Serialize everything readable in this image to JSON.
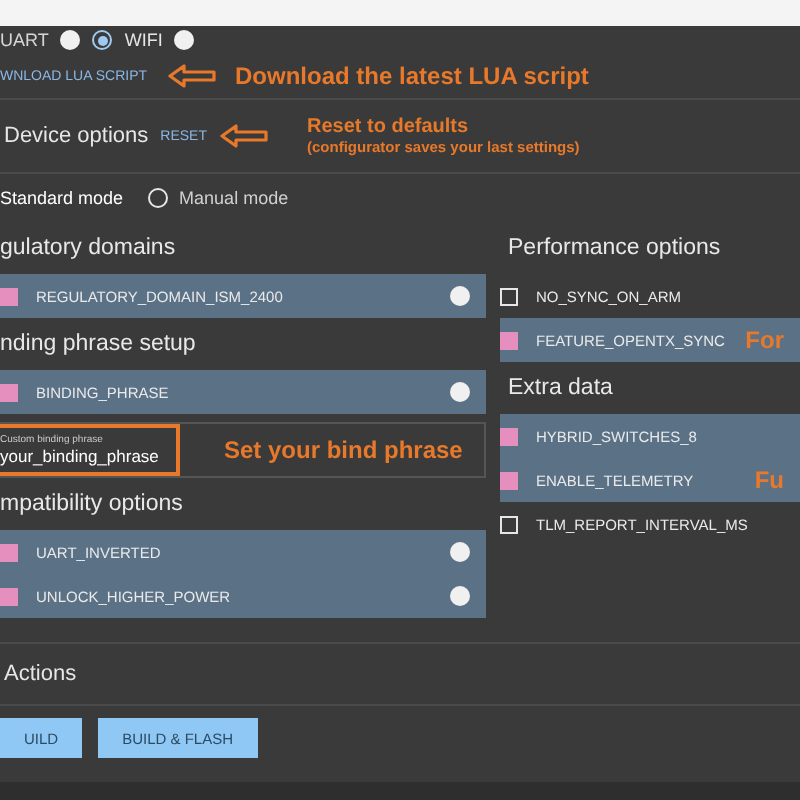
{
  "connection": {
    "options": [
      {
        "label": "UART",
        "selected": false
      },
      {
        "label": "WIFI",
        "selected": true
      }
    ]
  },
  "download": {
    "link": "WNLOAD LUA SCRIPT",
    "note": "Download the latest LUA script"
  },
  "device_options": {
    "title": "Device options",
    "reset": "RESET",
    "note_title": "Reset to defaults",
    "note_subtitle": "(configurator saves your last settings)"
  },
  "modes": [
    {
      "label": "Standard mode",
      "selected": true
    },
    {
      "label": "Manual mode",
      "selected": false
    }
  ],
  "left_groups": [
    {
      "title": "gulatory domains",
      "options": [
        {
          "label": "REGULATORY_DOMAIN_ISM_2400",
          "checked": true
        }
      ]
    },
    {
      "title": "nding phrase setup",
      "options": [
        {
          "label": "BINDING_PHRASE",
          "checked": true
        }
      ],
      "field": {
        "label": "Custom binding phrase",
        "value": "your_binding_phrase",
        "note": "Set your bind phrase"
      }
    },
    {
      "title": "mpatibility options",
      "options": [
        {
          "label": "UART_INVERTED",
          "checked": true
        },
        {
          "label": "UNLOCK_HIGHER_POWER",
          "checked": true
        }
      ]
    }
  ],
  "right_groups": [
    {
      "title": "Performance options",
      "options": [
        {
          "label": "NO_SYNC_ON_ARM",
          "checked": false
        },
        {
          "label": "FEATURE_OPENTX_SYNC",
          "checked": true,
          "note": "For"
        }
      ]
    },
    {
      "title": "Extra data",
      "options": [
        {
          "label": "HYBRID_SWITCHES_8",
          "checked": true
        },
        {
          "label": "ENABLE_TELEMETRY",
          "checked": true,
          "note": "Fu"
        },
        {
          "label": "TLM_REPORT_INTERVAL_MS",
          "checked": false
        }
      ]
    }
  ],
  "actions": {
    "title": "Actions",
    "buttons": [
      "UILD",
      "BUILD & FLASH"
    ]
  }
}
